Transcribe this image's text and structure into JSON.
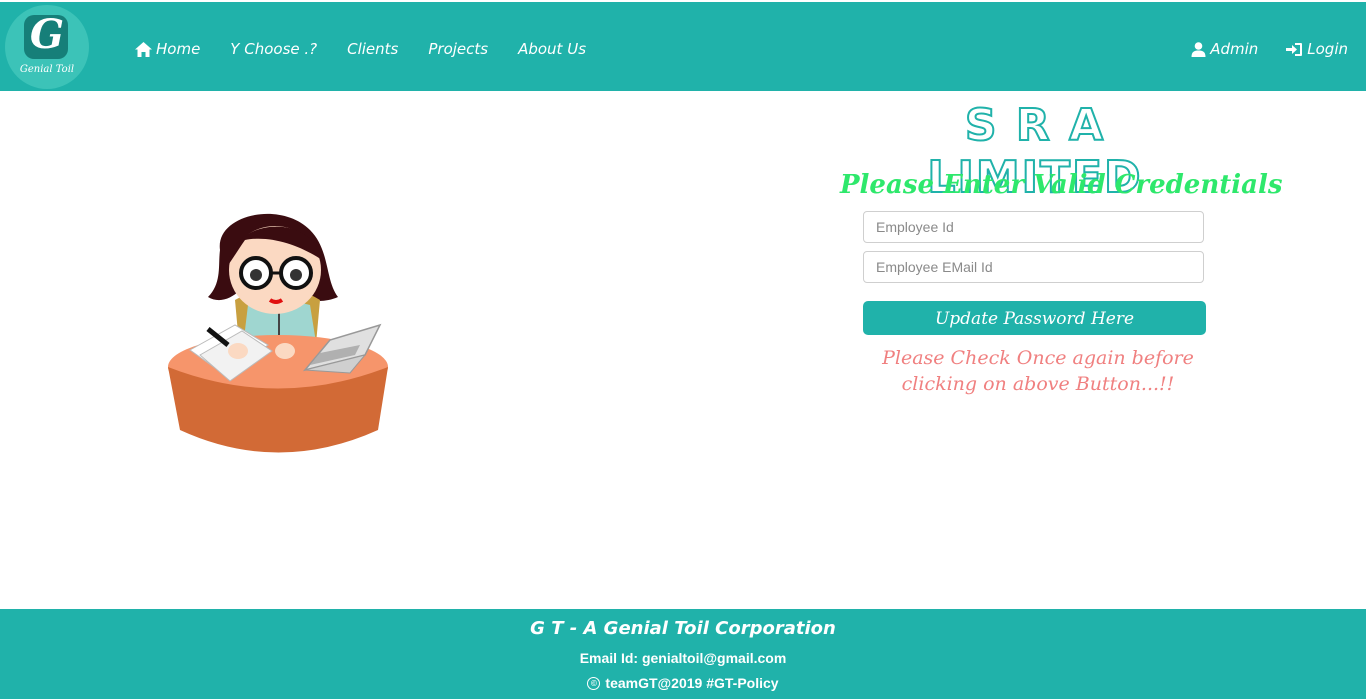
{
  "navbar": {
    "logo": {
      "letter": "G",
      "text": "Genial Toil"
    },
    "links": [
      {
        "label": "Home",
        "icon": "home-icon"
      },
      {
        "label": "Y Choose .?"
      },
      {
        "label": "Clients"
      },
      {
        "label": "Projects"
      },
      {
        "label": "About Us"
      }
    ],
    "right_links": [
      {
        "label": "Admin",
        "icon": "user-icon"
      },
      {
        "label": "Login",
        "icon": "login-icon"
      }
    ]
  },
  "form": {
    "brand": "S R A LIMITED",
    "heading": "Please Enter Valid Credentials",
    "employee_id_placeholder": "Employee Id",
    "employee_email_placeholder": "Employee EMail Id",
    "submit_label": "Update Password Here",
    "warning": "Please Check Once again before clicking on above Button...!!"
  },
  "footer": {
    "title": "G T - A Genial Toil Corporation",
    "email": "Email Id: genialtoil@gmail.com",
    "copyright": "teamGT@2019 #GT-Policy"
  },
  "colors": {
    "primary": "#20b2aa",
    "heading_green": "#2ee86c",
    "warning_pink": "#f08080"
  }
}
